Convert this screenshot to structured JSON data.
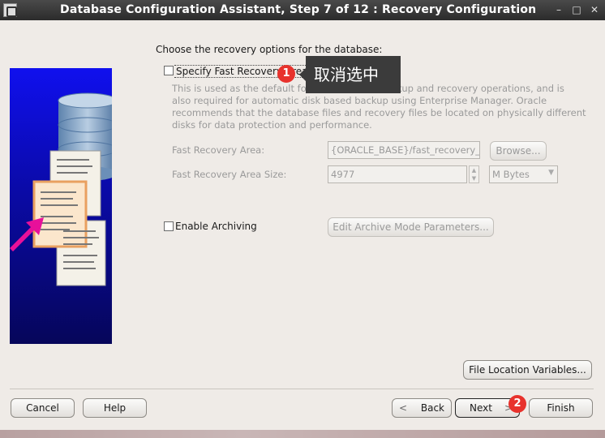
{
  "window": {
    "title": "Database Configuration Assistant, Step 7 of 12 : Recovery Configuration"
  },
  "main": {
    "intro": "Choose the recovery options for the database:",
    "fra_checkbox_label": "Specify Fast Recovery Area",
    "fra_checked": false,
    "description_lines": [
      "This is used as the default for all disk based backup and recovery operations, and is",
      "also required for automatic disk based backup using Enterprise Manager. Oracle",
      "recommends that the database files and recovery files be located on physically different",
      "disks for data protection and performance."
    ],
    "fra_label": "Fast Recovery Area:",
    "fra_value": "{ORACLE_BASE}/fast_recovery_area",
    "browse_label": "Browse...",
    "fra_size_label": "Fast Recovery Area Size:",
    "fra_size_value": "4977",
    "fra_size_unit": "M Bytes",
    "archiving_label": "Enable Archiving",
    "archiving_checked": false,
    "archive_params_label": "Edit Archive Mode Parameters...",
    "file_location_label": "File Location Variables..."
  },
  "footer": {
    "cancel": "Cancel",
    "help": "Help",
    "back": "Back",
    "next": "Next",
    "finish": "Finish"
  },
  "annotations": {
    "badge1": "1",
    "tooltip": "取消选中",
    "badge2": "2",
    "badge_color": "#e8322c"
  }
}
